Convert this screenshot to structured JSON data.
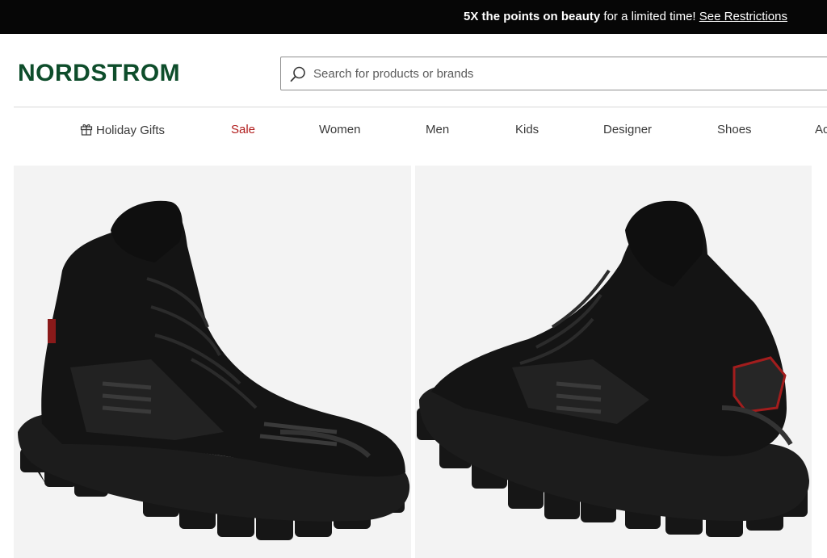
{
  "promo": {
    "strong": "5X the points on beauty",
    "text": " for a limited time! ",
    "link": "See Restrictions"
  },
  "header": {
    "logo": "NORDSTROM",
    "search_placeholder": "Search for products or brands"
  },
  "nav": {
    "items": [
      {
        "label": "Holiday Gifts",
        "icon": "gift-icon"
      },
      {
        "label": "Sale"
      },
      {
        "label": "Women"
      },
      {
        "label": "Men"
      },
      {
        "label": "Kids"
      },
      {
        "label": "Designer"
      },
      {
        "label": "Shoes"
      },
      {
        "label": "Ac"
      }
    ]
  },
  "gallery": {
    "images": [
      {
        "alt": "black high-top sneaker, side view"
      },
      {
        "alt": "black high-top sneaker, rear view"
      }
    ]
  },
  "colors": {
    "promo_bg": "#060606",
    "brand_green": "#0e4d2b",
    "sale_red": "#b01a1a",
    "photo_bg": "#f3f3f3"
  }
}
